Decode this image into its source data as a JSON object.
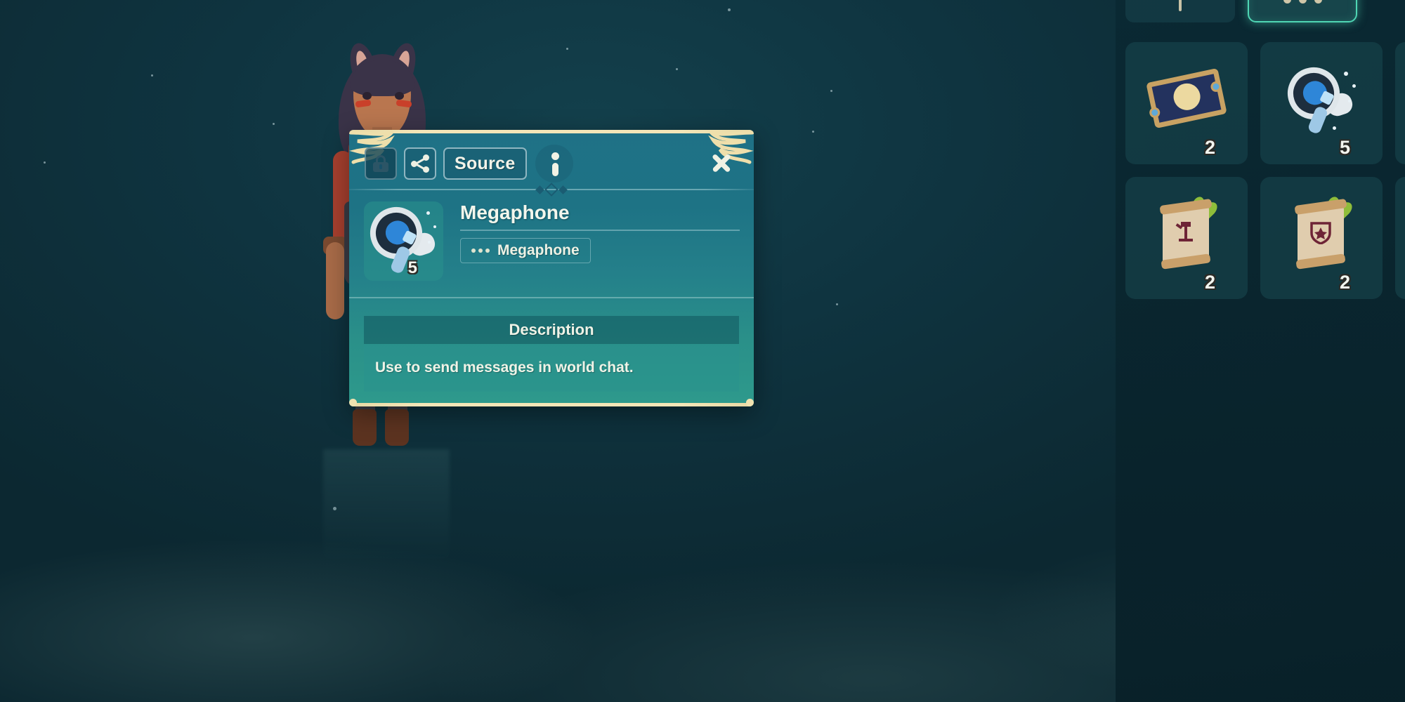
{
  "dialog": {
    "toolbar": {
      "lock_icon": "lock-icon",
      "share_icon": "share-icon",
      "source_label": "Source",
      "info_icon": "info-icon",
      "close_icon": "close-icon"
    },
    "item": {
      "name": "Megaphone",
      "quantity": "5",
      "tag_label": "Megaphone",
      "tag_icon": "ellipsis-icon",
      "icon": "megaphone-icon"
    },
    "description": {
      "header": "Description",
      "text": "Use to send messages in world chat."
    }
  },
  "inventory": {
    "tabs": [
      {
        "name": "tab-seeds",
        "icon": "sprout-icon",
        "selected": false
      },
      {
        "name": "tab-other",
        "icon": "ellipsis-icon",
        "selected": true
      }
    ],
    "slots": [
      {
        "name": "slot-ticket",
        "icon": "ticket-icon",
        "qty": "2"
      },
      {
        "name": "slot-megaphone",
        "icon": "megaphone-icon",
        "qty": "5"
      },
      {
        "name": "slot-seed-sack",
        "icon": "seed-sack-icon",
        "qty": ""
      },
      {
        "name": "slot-scroll-weapon",
        "icon": "scroll-weapon-icon",
        "qty": "2"
      },
      {
        "name": "slot-scroll-shield",
        "icon": "scroll-shield-icon",
        "qty": "2"
      },
      {
        "name": "slot-coin",
        "icon": "coin-icon",
        "qty": ""
      }
    ]
  },
  "colors": {
    "dialog_border_gold": "#f3e6b8",
    "dialog_top": "#1f7186",
    "dialog_bottom": "#2e9a8c",
    "selected_tab_glow": "#4fd6b4",
    "text_light": "#f2f5ef"
  }
}
